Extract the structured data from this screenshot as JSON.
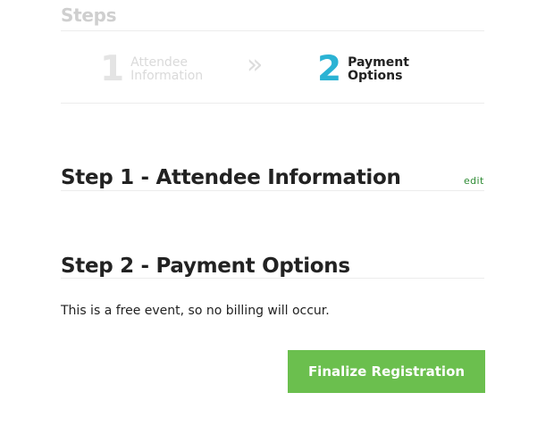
{
  "steps": {
    "title": "Steps",
    "items": [
      {
        "number": "1",
        "label_line1": "Attendee",
        "label_line2": "Information",
        "active": false
      },
      {
        "number": "2",
        "label_line1": "Payment",
        "label_line2": "Options",
        "active": true
      }
    ],
    "separator": "»"
  },
  "sections": {
    "step1": {
      "heading": "Step 1 - Attendee Information",
      "edit_label": "edit"
    },
    "step2": {
      "heading": "Step 2 - Payment Options",
      "note": "This is a free event, so no billing will occur."
    }
  },
  "actions": {
    "finalize_label": "Finalize Registration"
  },
  "colors": {
    "active_step": "#2bb3d4",
    "button": "#6bbf4e",
    "edit_link": "#2e8b34"
  }
}
